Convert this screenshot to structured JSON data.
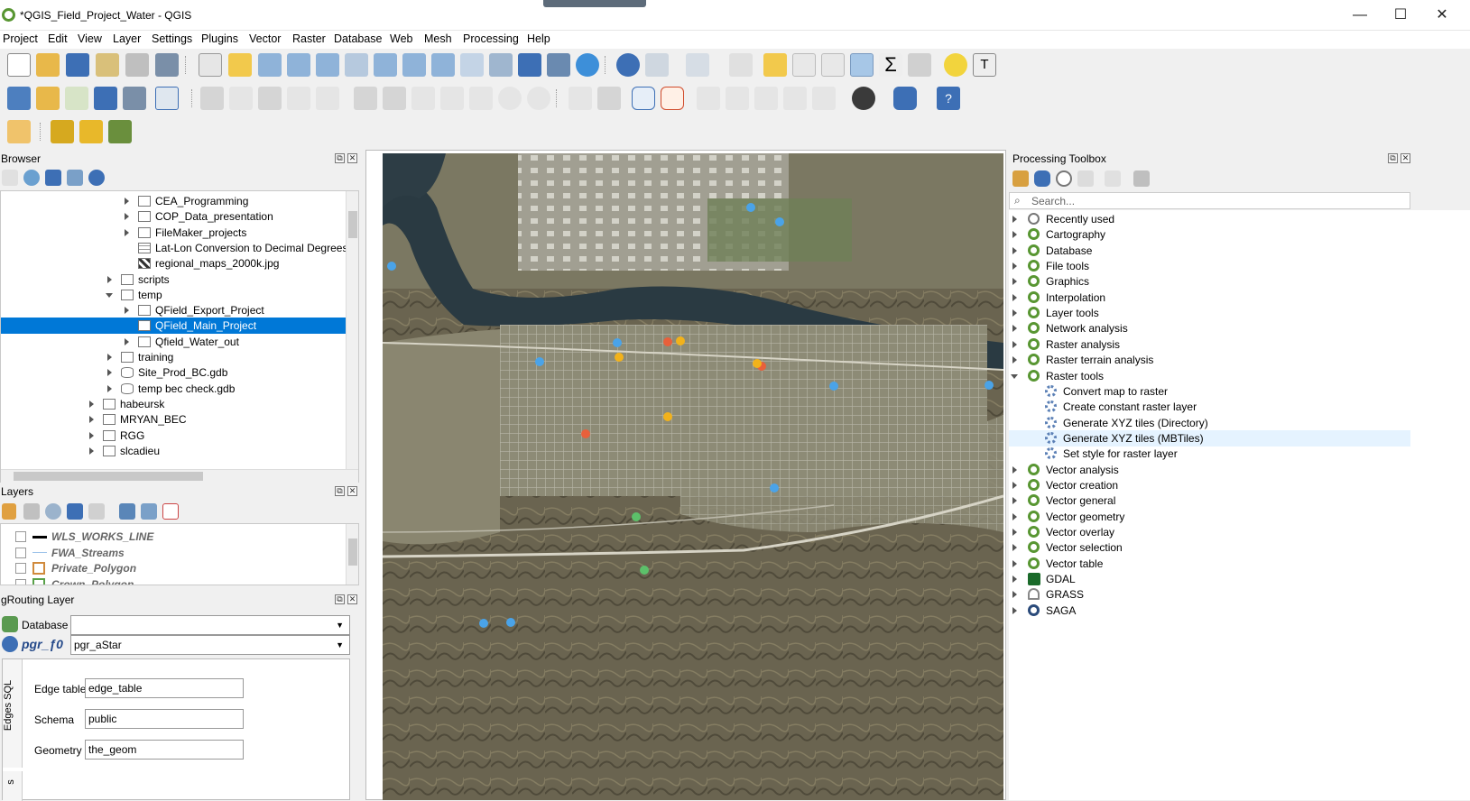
{
  "window": {
    "title": "*QGIS_Field_Project_Water - QGIS",
    "minimize": "—",
    "maximize": "☐",
    "close": "✕"
  },
  "menu": [
    "Project",
    "Edit",
    "View",
    "Layer",
    "Settings",
    "Plugins",
    "Vector",
    "Raster",
    "Database",
    "Web",
    "Mesh",
    "Processing",
    "Help"
  ],
  "browser": {
    "title": "Browser",
    "items": [
      {
        "label": "CEA_Programming",
        "type": "folder",
        "expand": true
      },
      {
        "label": "COP_Data_presentation",
        "type": "folder",
        "expand": true
      },
      {
        "label": "FileMaker_projects",
        "type": "folder",
        "expand": true
      },
      {
        "label": "Lat-Lon Conversion to Decimal Degrees.xl",
        "type": "table",
        "expand": false
      },
      {
        "label": "regional_maps_2000k.jpg",
        "type": "raster",
        "expand": false
      },
      {
        "label": "scripts",
        "type": "folder",
        "expand": true
      },
      {
        "label": "temp",
        "type": "folder",
        "expand": "open"
      },
      {
        "label": "QField_Export_Project",
        "type": "folder",
        "expand": true
      },
      {
        "label": "QField_Main_Project",
        "type": "folder",
        "expand": false,
        "selected": true
      },
      {
        "label": "Qfield_Water_out",
        "type": "folder",
        "expand": true
      },
      {
        "label": "training",
        "type": "folder",
        "expand": true
      },
      {
        "label": "Site_Prod_BC.gdb",
        "type": "db",
        "expand": true
      },
      {
        "label": "temp bec check.gdb",
        "type": "db",
        "expand": true
      },
      {
        "label": "habeursk",
        "type": "folder",
        "expand": true
      },
      {
        "label": "MRYAN_BEC",
        "type": "folder",
        "expand": true
      },
      {
        "label": "RGG",
        "type": "folder",
        "expand": true
      },
      {
        "label": "slcadieu",
        "type": "folder",
        "expand": true
      }
    ]
  },
  "layers": {
    "title": "Layers",
    "items": [
      {
        "label": "WLS_WORKS_LINE",
        "swatch": "#000000"
      },
      {
        "label": "FWA_Streams",
        "swatch": "#9ec3ea"
      },
      {
        "label": "Private_Polygon",
        "swatch": "#d08a3c"
      },
      {
        "label": "Crown_Polygon",
        "swatch": "#58a048"
      }
    ]
  },
  "pgrouting": {
    "title": "gRouting Layer",
    "database_label": "Database",
    "database_value": "",
    "function_label": "pgr_ƒ0",
    "function_value": "pgr_aStar",
    "side_tab": "Edges SQL",
    "side_tab2": "s",
    "edge_table_label": "Edge table",
    "edge_table_value": "edge_table",
    "schema_label": "Schema",
    "schema_value": "public",
    "geometry_label": "Geometry",
    "geometry_value": "the_geom"
  },
  "toolbox": {
    "title": "Processing Toolbox",
    "search_placeholder": "Search...",
    "groups": [
      {
        "label": "Recently used",
        "icon": "clock-icon"
      },
      {
        "label": "Cartography",
        "icon": "qgis-icon"
      },
      {
        "label": "Database",
        "icon": "qgis-icon"
      },
      {
        "label": "File tools",
        "icon": "qgis-icon"
      },
      {
        "label": "Graphics",
        "icon": "qgis-icon"
      },
      {
        "label": "Interpolation",
        "icon": "qgis-icon"
      },
      {
        "label": "Layer tools",
        "icon": "qgis-icon"
      },
      {
        "label": "Network analysis",
        "icon": "qgis-icon"
      },
      {
        "label": "Raster analysis",
        "icon": "qgis-icon"
      },
      {
        "label": "Raster terrain analysis",
        "icon": "qgis-icon"
      },
      {
        "label": "Raster tools",
        "icon": "qgis-icon",
        "open": true
      },
      {
        "label": "Convert map to raster",
        "icon": "gear-icon",
        "child": true
      },
      {
        "label": "Create constant raster layer",
        "icon": "gear-icon",
        "child": true
      },
      {
        "label": "Generate XYZ tiles (Directory)",
        "icon": "gear-icon",
        "child": true
      },
      {
        "label": "Generate XYZ tiles (MBTiles)",
        "icon": "gear-icon",
        "child": true,
        "hover": true
      },
      {
        "label": "Set style for raster layer",
        "icon": "gear-icon",
        "child": true
      },
      {
        "label": "Vector analysis",
        "icon": "qgis-icon"
      },
      {
        "label": "Vector creation",
        "icon": "qgis-icon"
      },
      {
        "label": "Vector general",
        "icon": "qgis-icon"
      },
      {
        "label": "Vector geometry",
        "icon": "qgis-icon"
      },
      {
        "label": "Vector overlay",
        "icon": "qgis-icon"
      },
      {
        "label": "Vector selection",
        "icon": "qgis-icon"
      },
      {
        "label": "Vector table",
        "icon": "qgis-icon"
      },
      {
        "label": "GDAL",
        "icon": "gdal-icon"
      },
      {
        "label": "GRASS",
        "icon": "grass-icon"
      },
      {
        "label": "SAGA",
        "icon": "saga-icon"
      }
    ]
  },
  "colors": {
    "qgis_green": "#589632",
    "selection_blue": "#0078d7",
    "hover": "#e5f3ff"
  }
}
